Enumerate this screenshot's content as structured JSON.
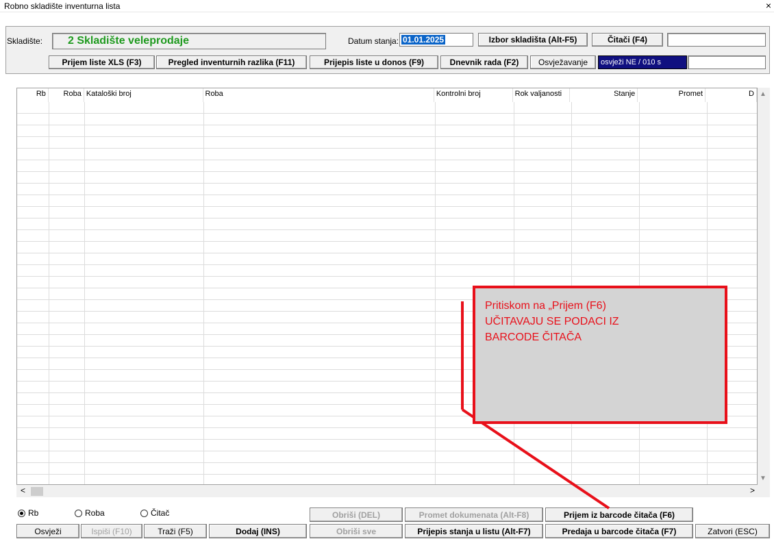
{
  "window": {
    "title": "Robno skladište inventurna lista",
    "close": "×"
  },
  "header": {
    "warehouse_label": "Skladište:",
    "warehouse_value": "2 Skladište veleprodaje",
    "date_label": "Datum stanja:",
    "date_value": "01.01.2025",
    "btn_select_warehouse": "Izbor skladišta (Alt-F5)",
    "btn_readers": "Čitači (F4)",
    "btn_import_xls": "Prijem liste XLS (F3)",
    "btn_review_diffs": "Pregled inventurnih razlika (F11)",
    "btn_transfer_list": "Prijepis liste u donos (F9)",
    "btn_work_log": "Dnevnik rada (F2)",
    "refresh_label": "Osvježavanje",
    "refresh_value": "osvježi NE / 010 s"
  },
  "grid": {
    "columns": [
      "Rb",
      "Roba",
      "Kataloški broj",
      "Roba",
      "Kontrolni broj",
      "Rok valjanosti",
      "Stanje",
      "Promet",
      "D"
    ]
  },
  "radios": [
    {
      "label": "Rb",
      "checked": true
    },
    {
      "label": "Roba",
      "checked": false
    },
    {
      "label": "Čitač",
      "checked": false
    }
  ],
  "footer": {
    "btn_delete": "Obriši (DEL)",
    "btn_doc_traffic": "Promet dokumenata (Alt-F8)",
    "btn_import_barcode": "Prijem iz barcode čitača (F6)",
    "btn_refresh": "Osvježi",
    "btn_print": "Ispiši (F10)",
    "btn_search": "Traži (F5)",
    "btn_add": "Dodaj (INS)",
    "btn_delete_all": "Obriši sve",
    "btn_copy_stock": "Prijepis stanja u listu (Alt-F7)",
    "btn_export_barcode": "Predaja u barcode čitača (F7)",
    "btn_close": "Zatvori (ESC)"
  },
  "annotation": {
    "line1": "Pritiskom na „Prijem  (F6)",
    "line2": "UČITAVAJU SE PODACI IZ",
    "line3": "BARCODE ČITAČA"
  },
  "colors": {
    "accent_red": "#e8101a",
    "warehouse_green": "#1f9a1f",
    "selection_blue": "#0a64c8",
    "refresh_bg": "#101080"
  }
}
